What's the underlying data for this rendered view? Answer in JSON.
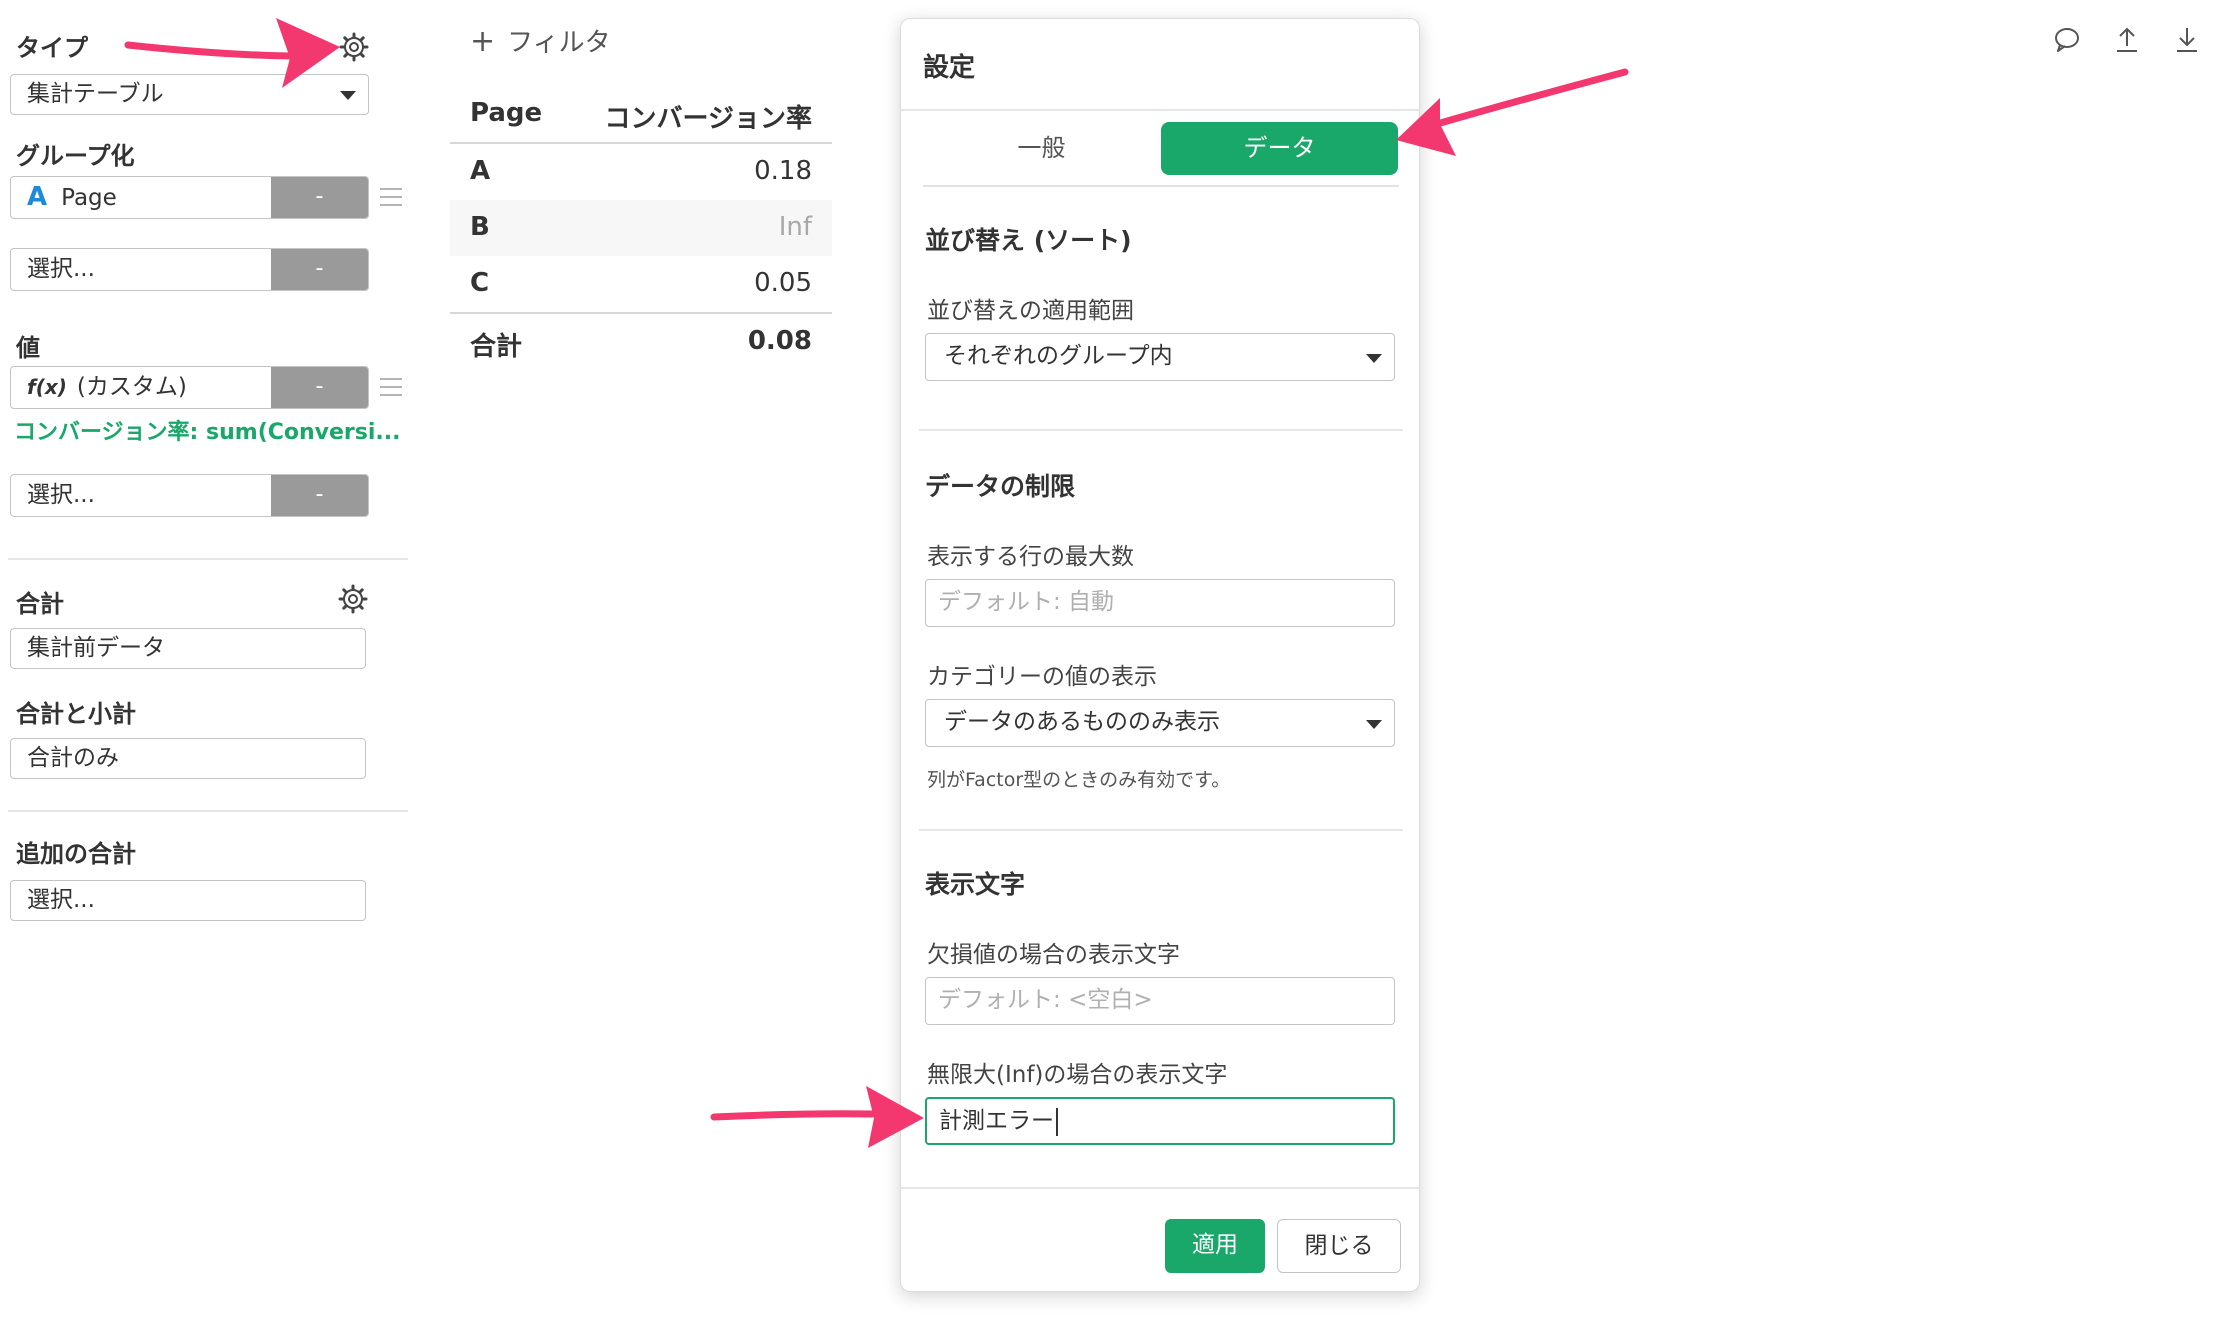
{
  "left_panel": {
    "type": {
      "label": "タイプ",
      "value": "集計テーブル"
    },
    "group": {
      "label": "グループ化",
      "item": {
        "icon": "A",
        "text": "Page",
        "remove": "-"
      },
      "select": {
        "text": "選択...",
        "remove": "-"
      }
    },
    "value": {
      "label": "値",
      "item": {
        "icon": "f(x)",
        "text": "(カスタム)",
        "remove": "-"
      },
      "formula": "コンバージョン率: sum(Conversi...",
      "select": {
        "text": "選択...",
        "remove": "-"
      }
    },
    "total": {
      "label": "合計",
      "value": "集計前データ"
    },
    "subtotal": {
      "label": "合計と小計",
      "value": "合計のみ"
    },
    "extra": {
      "label": "追加の合計",
      "value": "選択..."
    }
  },
  "filter": {
    "plus": "+",
    "label": "フィルタ"
  },
  "table": {
    "headers": [
      "Page",
      "コンバージョン率"
    ],
    "rows": [
      {
        "page": "A",
        "value": "0.18"
      },
      {
        "page": "B",
        "value": "Inf"
      },
      {
        "page": "C",
        "value": "0.05"
      }
    ],
    "total": {
      "label": "合計",
      "value": "0.08"
    }
  },
  "dialog": {
    "title": "設定",
    "tabs": {
      "general": "一般",
      "data": "データ"
    },
    "sort": {
      "heading": "並び替え (ソート)",
      "scope_label": "並び替えの適用範囲",
      "scope_value": "それぞれのグループ内"
    },
    "limit": {
      "heading": "データの制限",
      "max_rows_label": "表示する行の最大数",
      "max_rows_placeholder": "デフォルト: 自動",
      "category_label": "カテゴリーの値の表示",
      "category_value": "データのあるもののみ表示",
      "help": "列がFactor型のときのみ有効です。"
    },
    "display": {
      "heading": "表示文字",
      "na_label": "欠損値の場合の表示文字",
      "na_placeholder": "デフォルト: <空白>",
      "inf_label": "無限大(Inf)の場合の表示文字",
      "inf_value": "計測エラー"
    },
    "buttons": {
      "apply": "適用",
      "close": "閉じる"
    }
  },
  "colors": {
    "accent": "#1aa86a",
    "arrow": "#f2386f",
    "icon_blue": "#1f8ad8"
  }
}
